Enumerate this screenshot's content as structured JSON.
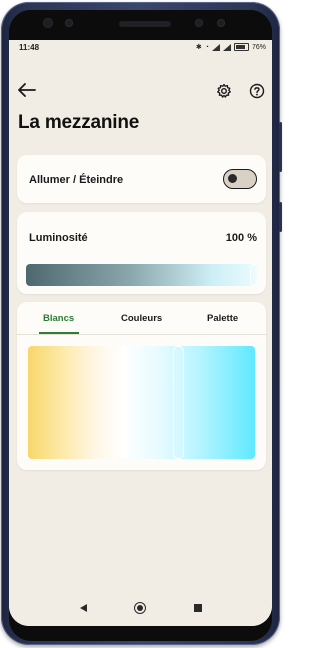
{
  "status_bar": {
    "time": "11:48",
    "battery": "76"
  },
  "header": {
    "back_icon": "arrow-left-icon",
    "settings_icon": "gear-icon",
    "help_icon": "help-circle-icon"
  },
  "page": {
    "title": "La mezzanine"
  },
  "power_card": {
    "label": "Allumer / Éteindre",
    "toggle_on": false
  },
  "brightness_card": {
    "label": "Luminosité",
    "value": "100 %",
    "level": 1.0
  },
  "color_card": {
    "tabs": [
      {
        "label": "Blancs",
        "active": true
      },
      {
        "label": "Couleurs",
        "active": false
      },
      {
        "label": "Palette",
        "active": false
      }
    ],
    "white_level": 0.67
  },
  "colors": {
    "accent": "#2e7d32",
    "background": "#f1ede4",
    "card": "#fdfcf9"
  },
  "navbar": {
    "back_icon": "nav-back-icon",
    "home_icon": "nav-home-icon",
    "recents_icon": "nav-recents-icon"
  }
}
